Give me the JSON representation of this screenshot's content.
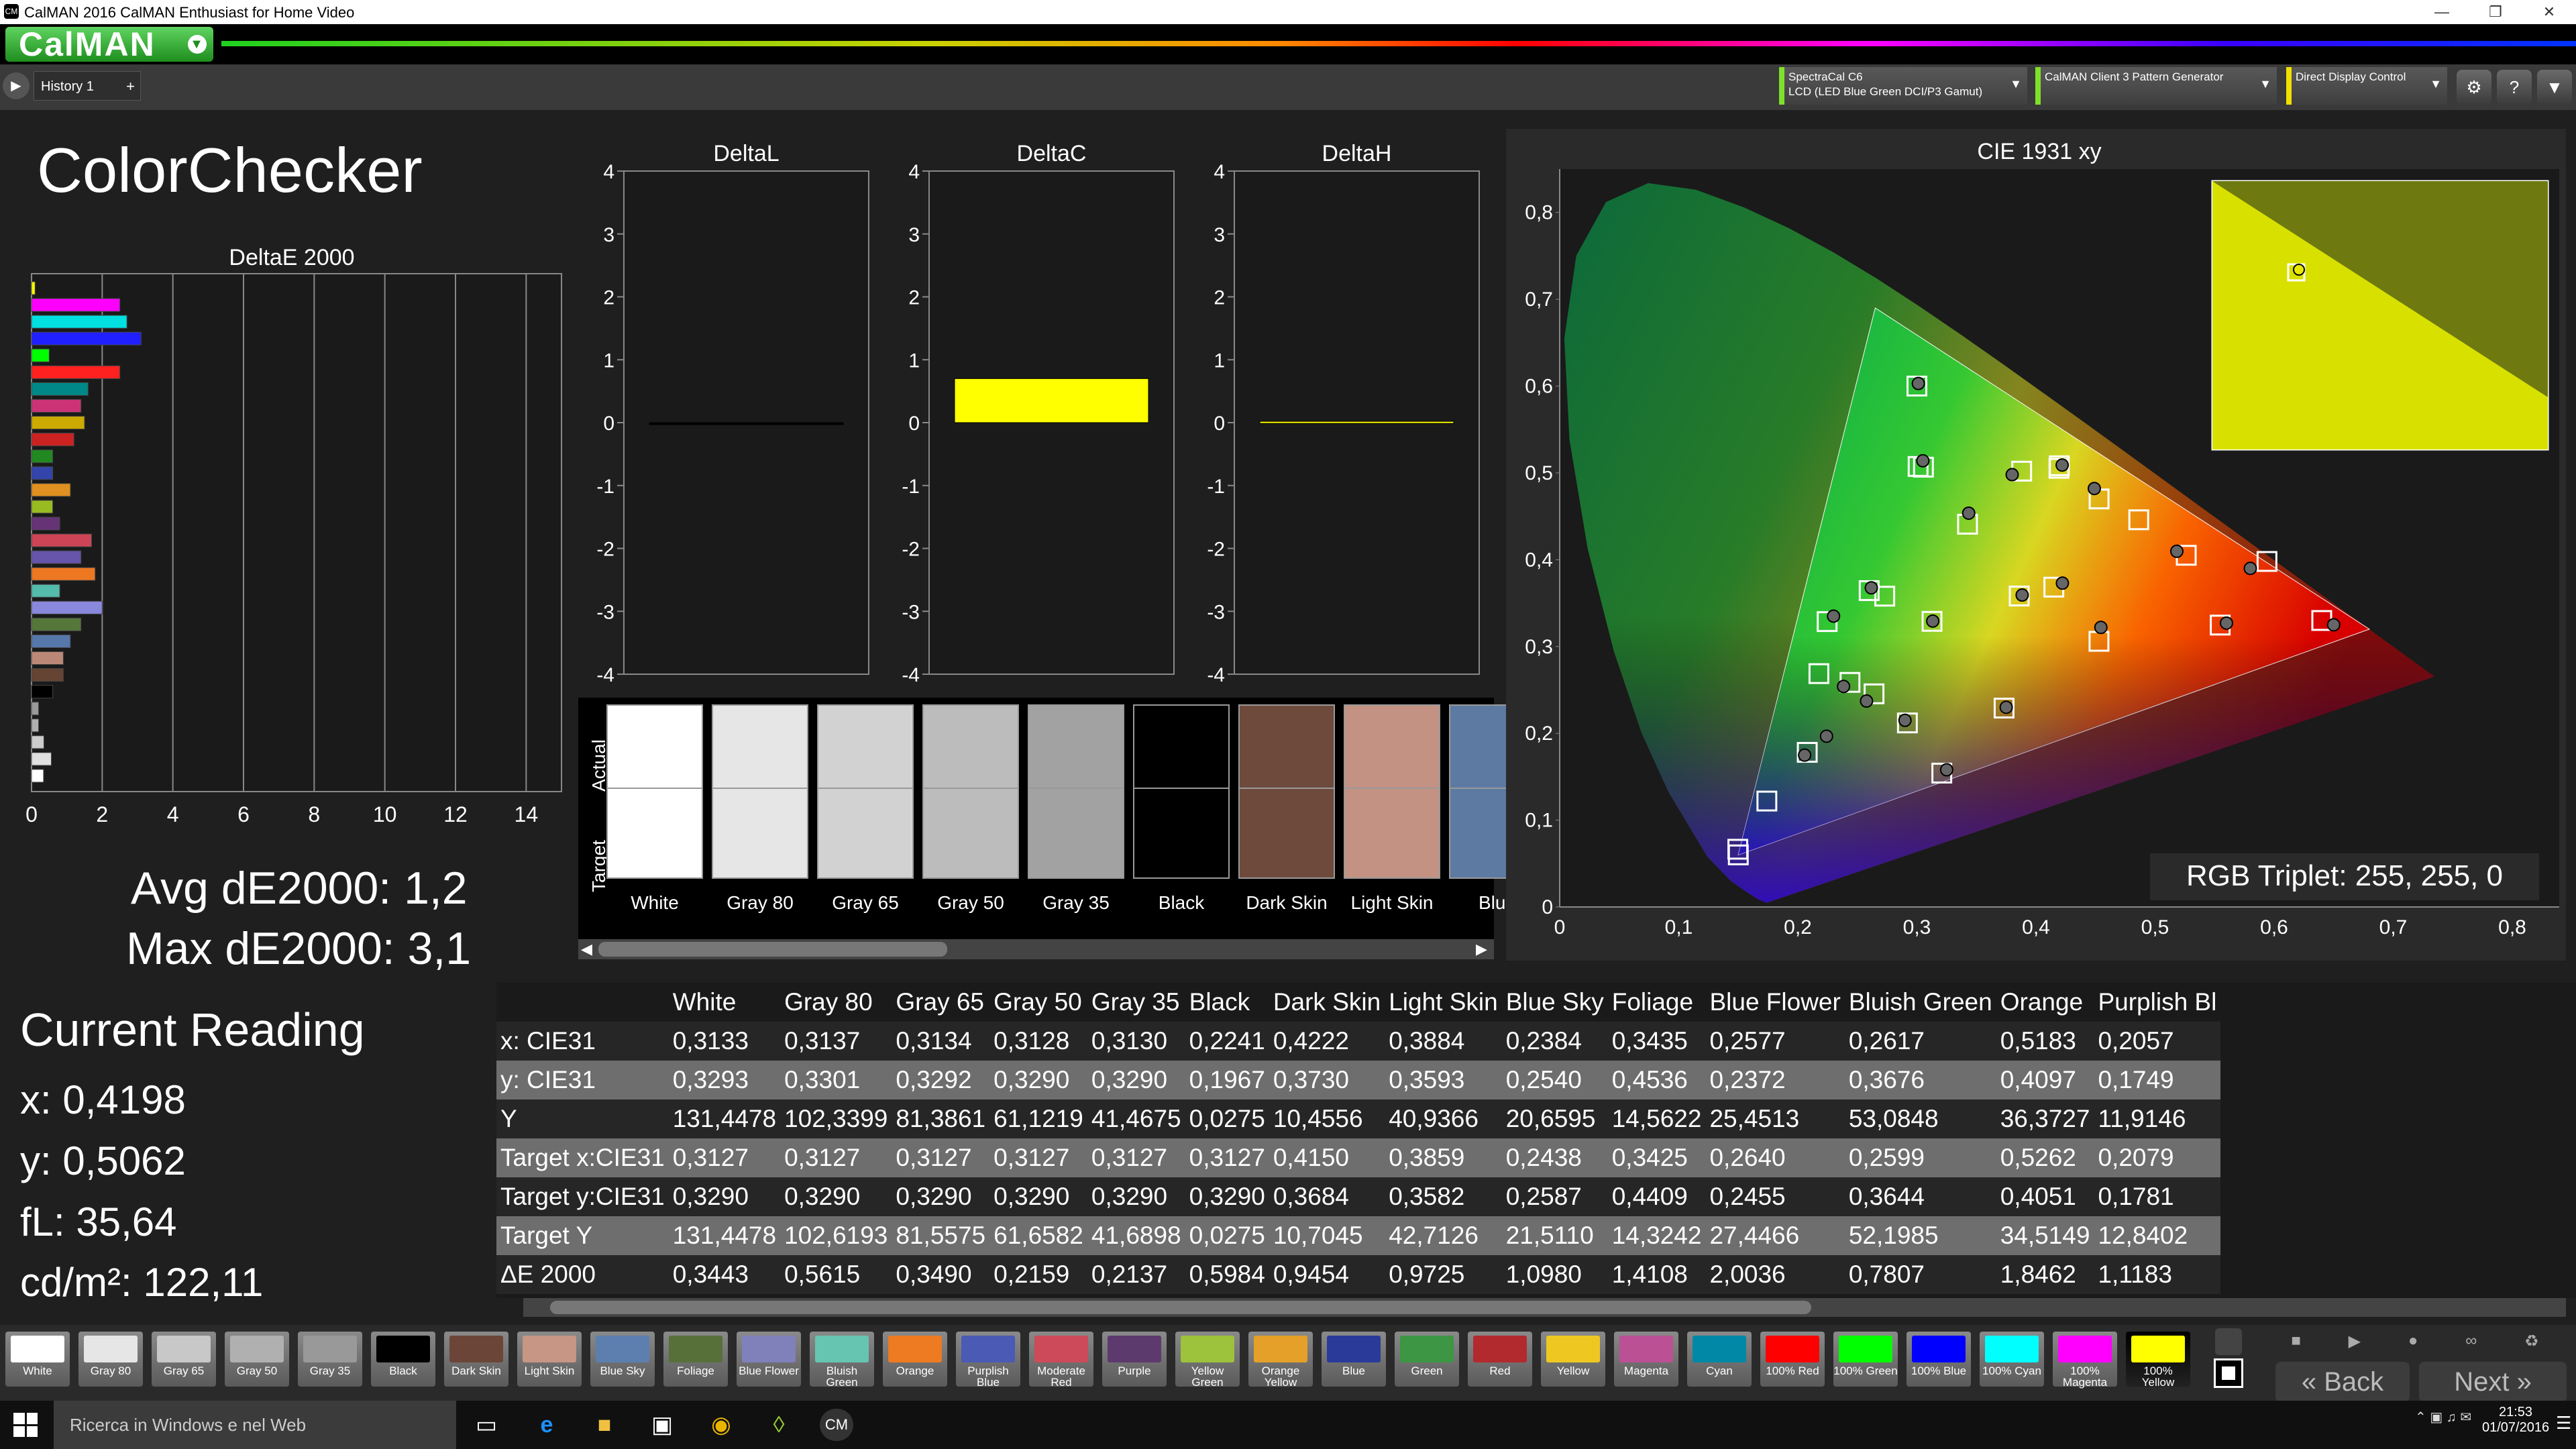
{
  "window": {
    "title": "CalMAN 2016 CalMAN Enthusiast for Home Video",
    "app_icon": "CM"
  },
  "header": {
    "logo": "CalMAN",
    "history_tab": "History 1",
    "add_tab": "+"
  },
  "devices": [
    {
      "line1": "SpectraCal C6",
      "line2": "LCD (LED Blue Green DCI/P3 Gamut)"
    },
    {
      "line1": "CalMAN Client 3 Pattern Generator",
      "line2": ""
    },
    {
      "line1": "Direct Display Control",
      "line2": ""
    }
  ],
  "page_title": "ColorChecker",
  "deltae": {
    "title": "DeltaE 2000",
    "x_ticks": [
      "0",
      "2",
      "4",
      "6",
      "8",
      "10",
      "12",
      "14"
    ],
    "xlim": [
      0,
      15
    ],
    "bars": [
      {
        "v": 0.1,
        "c": "#ffff00"
      },
      {
        "v": 2.5,
        "c": "#ff00ff"
      },
      {
        "v": 2.7,
        "c": "#00e0e0"
      },
      {
        "v": 3.1,
        "c": "#2020ff"
      },
      {
        "v": 0.5,
        "c": "#00ff00"
      },
      {
        "v": 2.5,
        "c": "#ff2020"
      },
      {
        "v": 1.6,
        "c": "#008888"
      },
      {
        "v": 1.4,
        "c": "#cc3377"
      },
      {
        "v": 1.5,
        "c": "#ccaa00"
      },
      {
        "v": 1.2,
        "c": "#cc2222"
      },
      {
        "v": 0.6,
        "c": "#228822"
      },
      {
        "v": 0.6,
        "c": "#3344aa"
      },
      {
        "v": 1.1,
        "c": "#e09020"
      },
      {
        "v": 0.6,
        "c": "#99bb22"
      },
      {
        "v": 0.8,
        "c": "#663377"
      },
      {
        "v": 1.7,
        "c": "#cc4455"
      },
      {
        "v": 1.4,
        "c": "#6655aa"
      },
      {
        "v": 1.8,
        "c": "#ee7722"
      },
      {
        "v": 0.8,
        "c": "#55bbaa"
      },
      {
        "v": 2.0,
        "c": "#8888dd"
      },
      {
        "v": 1.4,
        "c": "#55773a"
      },
      {
        "v": 1.1,
        "c": "#5577aa"
      },
      {
        "v": 0.9,
        "c": "#bb8877"
      },
      {
        "v": 0.9,
        "c": "#664433"
      },
      {
        "v": 0.6,
        "c": "#000000"
      },
      {
        "v": 0.2,
        "c": "#999999"
      },
      {
        "v": 0.2,
        "c": "#b0b0b0"
      },
      {
        "v": 0.35,
        "c": "#cccccc"
      },
      {
        "v": 0.56,
        "c": "#e0e0e0"
      },
      {
        "v": 0.34,
        "c": "#ffffff"
      }
    ]
  },
  "summary": {
    "avg": "Avg dE2000: 1,2",
    "max": "Max dE2000: 3,1"
  },
  "current_reading": {
    "title": "Current Reading",
    "x": "x: 0,4198",
    "y": "y: 0,5062",
    "fl": "fL: 35,64",
    "cdm2": "cd/m²: 122,11"
  },
  "deltas": [
    {
      "title": "DeltaL",
      "value": 0.0,
      "color": "#000000"
    },
    {
      "title": "DeltaC",
      "value": 0.7,
      "color": "#ffff00"
    },
    {
      "title": "DeltaH",
      "value": 0.02,
      "color": "#ffff00"
    }
  ],
  "delta_ticks": [
    "4",
    "3",
    "2",
    "1",
    "0",
    "-1",
    "-2",
    "-3",
    "-4"
  ],
  "patches": {
    "actual_label": "Actual",
    "target_label": "Target",
    "items": [
      {
        "name": "White",
        "actual": "#ffffff",
        "target": "#ffffff"
      },
      {
        "name": "Gray 80",
        "actual": "#e6e6e6",
        "target": "#e6e6e6"
      },
      {
        "name": "Gray 65",
        "actual": "#d2d2d2",
        "target": "#d2d2d2"
      },
      {
        "name": "Gray 50",
        "actual": "#bcbcbc",
        "target": "#bcbcbc"
      },
      {
        "name": "Gray 35",
        "actual": "#a2a2a2",
        "target": "#a2a2a2"
      },
      {
        "name": "Black",
        "actual": "#000000",
        "target": "#000000"
      },
      {
        "name": "Dark Skin",
        "actual": "#6e4a3c",
        "target": "#6e4a3c"
      },
      {
        "name": "Light Skin",
        "actual": "#c39282",
        "target": "#c39282"
      },
      {
        "name": "Blue",
        "actual": "#5d7aa3",
        "target": "#5d7aa3"
      }
    ]
  },
  "cie": {
    "title": "CIE 1931 xy",
    "x_ticks": [
      "0",
      "0,1",
      "0,2",
      "0,3",
      "0,4",
      "0,5",
      "0,6",
      "0,7",
      "0,8"
    ],
    "y_ticks": [
      "0",
      "0,1",
      "0,2",
      "0,3",
      "0,4",
      "0,5",
      "0,6",
      "0,7",
      "0,8"
    ],
    "xlim": [
      0,
      0.8
    ],
    "ylim": [
      0,
      0.85
    ],
    "gamut": [
      [
        0.68,
        0.32
      ],
      [
        0.265,
        0.69
      ],
      [
        0.15,
        0.06
      ]
    ],
    "targets": [
      [
        0.3127,
        0.329
      ],
      [
        0.415,
        0.3684
      ],
      [
        0.3859,
        0.3582
      ],
      [
        0.2438,
        0.2587
      ],
      [
        0.3425,
        0.4409
      ],
      [
        0.264,
        0.2455
      ],
      [
        0.2599,
        0.3644
      ],
      [
        0.5262,
        0.4051
      ],
      [
        0.2079,
        0.1781
      ],
      [
        0.4529,
        0.306
      ],
      [
        0.301,
        0.5074
      ],
      [
        0.453,
        0.47
      ],
      [
        0.1496,
        0.0665
      ],
      [
        0.3055,
        0.5066
      ],
      [
        0.5547,
        0.3247
      ],
      [
        0.4196,
        0.5082
      ],
      [
        0.3732,
        0.2291
      ],
      [
        0.2177,
        0.2688
      ],
      [
        0.64,
        0.33
      ],
      [
        0.3,
        0.6
      ],
      [
        0.15,
        0.06
      ],
      [
        0.2246,
        0.3287
      ],
      [
        0.3209,
        0.1542
      ],
      [
        0.4193,
        0.5053
      ],
      [
        0.4863,
        0.446
      ],
      [
        0.388,
        0.502
      ],
      [
        0.273,
        0.358
      ],
      [
        0.174,
        0.122
      ],
      [
        0.292,
        0.212
      ],
      [
        0.594,
        0.398
      ]
    ],
    "actuals": [
      [
        0.3133,
        0.3293
      ],
      [
        0.4222,
        0.373
      ],
      [
        0.3884,
        0.3593
      ],
      [
        0.2384,
        0.254
      ],
      [
        0.3435,
        0.4536
      ],
      [
        0.2577,
        0.2372
      ],
      [
        0.2617,
        0.3676
      ],
      [
        0.5183,
        0.4097
      ],
      [
        0.2057,
        0.1749
      ],
      [
        0.2241,
        0.1967
      ],
      [
        0.4545,
        0.322
      ],
      [
        0.305,
        0.514
      ],
      [
        0.56,
        0.327
      ],
      [
        0.422,
        0.509
      ],
      [
        0.375,
        0.23
      ],
      [
        0.3012,
        0.603
      ],
      [
        0.65,
        0.325
      ],
      [
        0.23,
        0.335
      ],
      [
        0.325,
        0.158
      ],
      [
        0.38,
        0.498
      ],
      [
        0.449,
        0.482
      ],
      [
        0.29,
        0.215
      ],
      [
        0.58,
        0.39
      ]
    ],
    "readout": "RGB Triplet: 255, 255, 0",
    "inset_point": [
      0.42,
      0.506
    ]
  },
  "table": {
    "columns": [
      "",
      "White",
      "Gray 80",
      "Gray 65",
      "Gray 50",
      "Gray 35",
      "Black",
      "Dark Skin",
      "Light Skin",
      "Blue Sky",
      "Foliage",
      "Blue Flower",
      "Bluish Green",
      "Orange",
      "Purplish Bl"
    ],
    "rows": [
      [
        "x: CIE31",
        "0,3133",
        "0,3137",
        "0,3134",
        "0,3128",
        "0,3130",
        "0,2241",
        "0,4222",
        "0,3884",
        "0,2384",
        "0,3435",
        "0,2577",
        "0,2617",
        "0,5183",
        "0,2057"
      ],
      [
        "y: CIE31",
        "0,3293",
        "0,3301",
        "0,3292",
        "0,3290",
        "0,3290",
        "0,1967",
        "0,3730",
        "0,3593",
        "0,2540",
        "0,4536",
        "0,2372",
        "0,3676",
        "0,4097",
        "0,1749"
      ],
      [
        "Y",
        "131,4478",
        "102,3399",
        "81,3861",
        "61,1219",
        "41,4675",
        "0,0275",
        "10,4556",
        "40,9366",
        "20,6595",
        "14,5622",
        "25,4513",
        "53,0848",
        "36,3727",
        "11,9146"
      ],
      [
        "Target x:CIE31",
        "0,3127",
        "0,3127",
        "0,3127",
        "0,3127",
        "0,3127",
        "0,3127",
        "0,4150",
        "0,3859",
        "0,2438",
        "0,3425",
        "0,2640",
        "0,2599",
        "0,5262",
        "0,2079"
      ],
      [
        "Target y:CIE31",
        "0,3290",
        "0,3290",
        "0,3290",
        "0,3290",
        "0,3290",
        "0,3290",
        "0,3684",
        "0,3582",
        "0,2587",
        "0,4409",
        "0,2455",
        "0,3644",
        "0,4051",
        "0,1781"
      ],
      [
        "Target Y",
        "131,4478",
        "102,6193",
        "81,5575",
        "61,6582",
        "41,6898",
        "0,0275",
        "10,7045",
        "42,7126",
        "21,5110",
        "14,3242",
        "27,4466",
        "52,1985",
        "34,5149",
        "12,8402"
      ],
      [
        "ΔE 2000",
        "0,3443",
        "0,5615",
        "0,3490",
        "0,2159",
        "0,2137",
        "0,5984",
        "0,9454",
        "0,9725",
        "1,0980",
        "1,4108",
        "2,0036",
        "0,7807",
        "1,8462",
        "1,1183"
      ]
    ]
  },
  "swatches": [
    {
      "l": "White",
      "c": "#ffffff"
    },
    {
      "l": "Gray 80",
      "c": "#e6e6e6"
    },
    {
      "l": "Gray 65",
      "c": "#c8c8c8"
    },
    {
      "l": "Gray 50",
      "c": "#b0b0b0"
    },
    {
      "l": "Gray 35",
      "c": "#999999"
    },
    {
      "l": "Black",
      "c": "#000000"
    },
    {
      "l": "Dark Skin",
      "c": "#6b4638"
    },
    {
      "l": "Light Skin",
      "c": "#c79684"
    },
    {
      "l": "Blue Sky",
      "c": "#5c7fb0"
    },
    {
      "l": "Foliage",
      "c": "#57703a"
    },
    {
      "l": "Blue Flower",
      "c": "#8080bb"
    },
    {
      "l": "Bluish Green",
      "c": "#66c5b0"
    },
    {
      "l": "Orange",
      "c": "#ee7a22"
    },
    {
      "l": "Purplish Blue",
      "c": "#4a5ab5"
    },
    {
      "l": "Moderate Red",
      "c": "#cc4a5a"
    },
    {
      "l": "Purple",
      "c": "#5c3a6e"
    },
    {
      "l": "Yellow Green",
      "c": "#9dc23c"
    },
    {
      "l": "Orange Yellow",
      "c": "#e4a028"
    },
    {
      "l": "Blue",
      "c": "#2a3a99"
    },
    {
      "l": "Green",
      "c": "#3c9644"
    },
    {
      "l": "Red",
      "c": "#b22a2e"
    },
    {
      "l": "Yellow",
      "c": "#eec821"
    },
    {
      "l": "Magenta",
      "c": "#bb5095"
    },
    {
      "l": "Cyan",
      "c": "#0088a6"
    },
    {
      "l": "100% Red",
      "c": "#ff0000"
    },
    {
      "l": "100% Green",
      "c": "#00ff00"
    },
    {
      "l": "100% Blue",
      "c": "#0000ff"
    },
    {
      "l": "100% Cyan",
      "c": "#00ffff"
    },
    {
      "l": "100% Magenta",
      "c": "#ff00ff"
    },
    {
      "l": "100% Yellow",
      "c": "#ffff00"
    }
  ],
  "nav": {
    "back": "Back",
    "next": "Next"
  },
  "taskbar": {
    "search": "Ricerca in Windows e nel Web",
    "time": "21:53",
    "date": "01/07/2016"
  }
}
